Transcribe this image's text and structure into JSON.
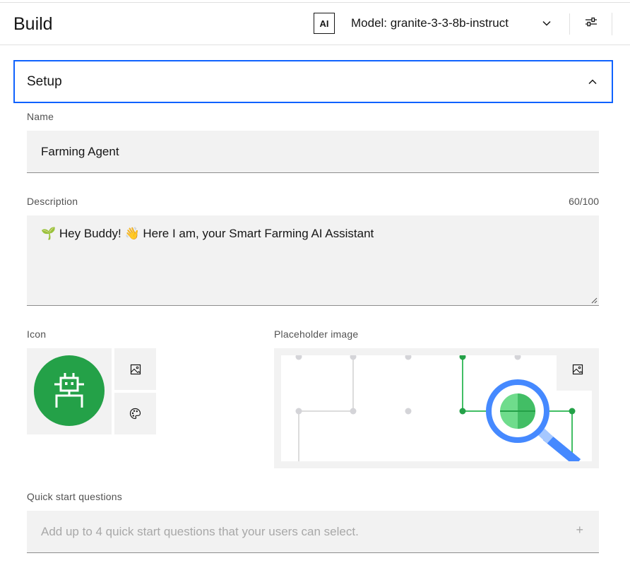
{
  "header": {
    "title": "Build",
    "ai_badge": "AI",
    "model_label": "Model: granite-3-3-8b-instruct"
  },
  "setup": {
    "title": "Setup",
    "name_label": "Name",
    "name_value": "Farming Agent",
    "description_label": "Description",
    "description_counter": "60/100",
    "description_value": "🌱 Hey Buddy! 👋 Here I am, your Smart Farming AI Assistant",
    "icon_label": "Icon",
    "placeholder_label": "Placeholder image",
    "quick_start_label": "Quick start questions",
    "quick_start_placeholder": "Add up to 4 quick start questions that your users can select.",
    "quick_start_add": "+"
  },
  "colors": {
    "accent": "#0f62fe",
    "icon_green": "#24a148",
    "field_bg": "#f2f2f2"
  },
  "icons": [
    "chevron-down-icon",
    "settings-sliders-icon",
    "chevron-up-icon",
    "robot-icon",
    "image-icon",
    "palette-icon",
    "magnifier-icon",
    "plus-icon"
  ]
}
